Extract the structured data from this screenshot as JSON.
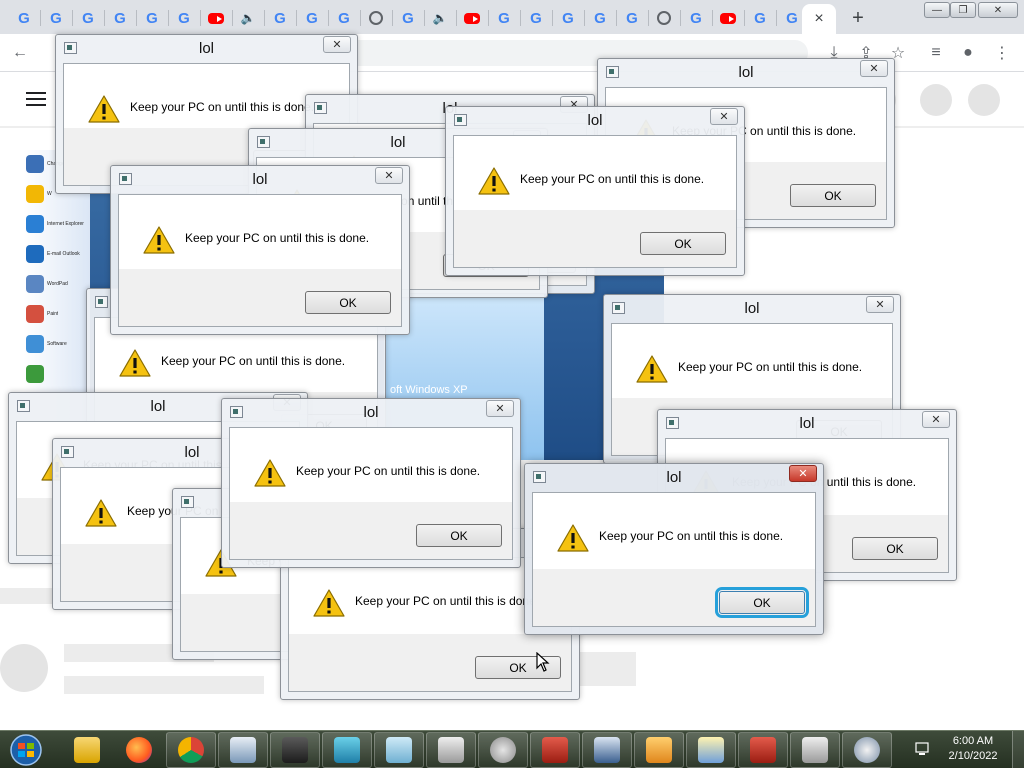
{
  "browser": {
    "tab_icons": [
      "google-icon",
      "google-icon",
      "google-icon",
      "google-icon",
      "google-icon",
      "google-icon",
      "youtube-icon",
      "speaker-icon",
      "google-icon",
      "google-icon",
      "google-icon",
      "wordpress-icon",
      "google-icon",
      "speaker-icon",
      "youtube-icon",
      "google-icon",
      "google-icon",
      "google-icon",
      "google-icon",
      "google-icon",
      "wordpress-icon",
      "google-icon",
      "youtube-icon",
      "google-icon",
      "google-icon"
    ],
    "google_glyph": "G",
    "active_tab_close": "×",
    "new_tab_label": "+",
    "window_buttons": {
      "minimize": "—",
      "maximize": "❐",
      "close": "✕"
    }
  },
  "dialog": {
    "title": "lol",
    "message": "Keep your PC on until this is done.",
    "ok_label": "OK",
    "close_glyph": "✕"
  },
  "desktop_fragment": {
    "sidebar_labels": [
      "Change Lang",
      "W",
      "Internet Explorer",
      "E-mail Outlook",
      "WordPad",
      "Paint",
      "Software",
      ""
    ],
    "brand_text": "oft Windows XP"
  },
  "taskbar": {
    "clock_time": "6:00 AM",
    "clock_date": "2/10/2022",
    "items": [
      "windows-explorer-icon",
      "firefox-icon",
      "chrome-icon",
      "window-app-icon",
      "microphone-app-icon",
      "cube-app-icon",
      "notepad-app-icon",
      "printer-app-icon",
      "speaker-app-icon",
      "toolbox-app-icon",
      "monitor-app-icon",
      "media-player-app-icon",
      "chat-app-icon",
      "toolbox-app-icon",
      "printer-app-icon",
      "network-app-icon"
    ]
  },
  "colors": {
    "tabstrip": "#dee1e6",
    "taskbar": "#2b3627",
    "focus_ring": "#26a0da",
    "warning_yellow": "#f5c211"
  }
}
